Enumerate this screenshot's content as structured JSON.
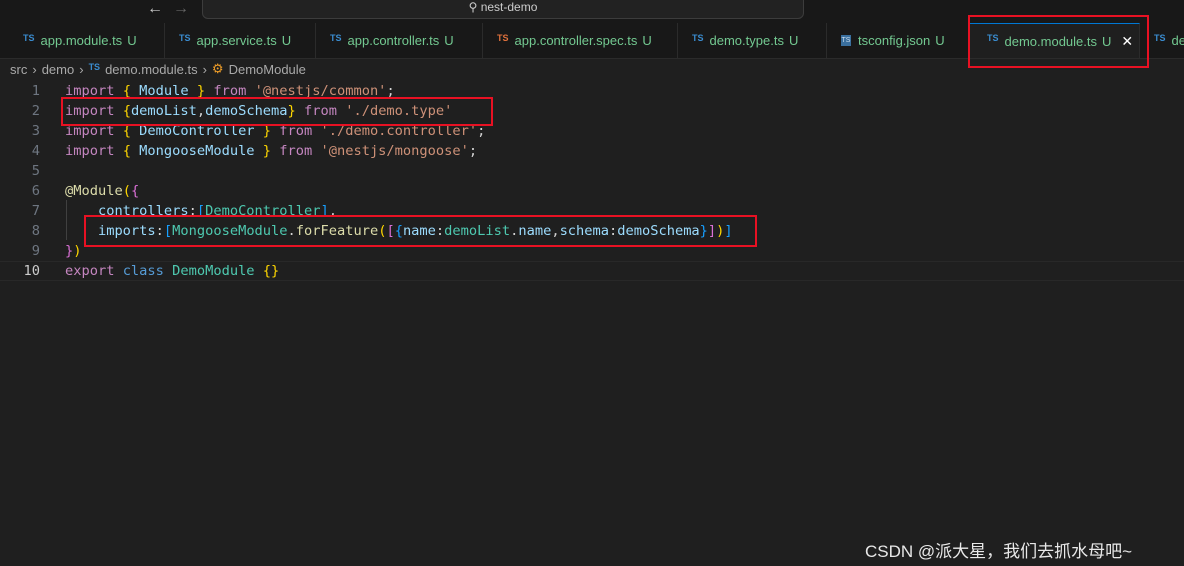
{
  "titlebar": {
    "back_icon": "arrow-left",
    "forward_icon": "arrow-right",
    "search": "nest-demo"
  },
  "tabs": [
    {
      "label": "app.module.ts",
      "badge": "U",
      "icon": "TS"
    },
    {
      "label": "app.service.ts",
      "badge": "U",
      "icon": "TS"
    },
    {
      "label": "app.controller.ts",
      "badge": "U",
      "icon": "TS"
    },
    {
      "label": "app.controller.spec.ts",
      "badge": "U",
      "icon": "TS"
    },
    {
      "label": "demo.type.ts",
      "badge": "U",
      "icon": "TS"
    },
    {
      "label": "tsconfig.json",
      "badge": "U",
      "icon": "TS"
    },
    {
      "label": "demo.module.ts",
      "badge": "U",
      "icon": "TS",
      "active": true
    },
    {
      "label": "de",
      "icon": "TS"
    }
  ],
  "breadcrumb": {
    "items": [
      "src",
      "demo",
      "demo.module.ts",
      "DemoModule"
    ],
    "file_icon": "TS"
  },
  "colors": {
    "kw": "#c586c0",
    "br": "#ffd700",
    "br2": "#da70d6",
    "br3": "#179fff",
    "id": "#9cdcfe",
    "cls": "#4ec9b0",
    "str": "#ce9178",
    "p": "#d4d4d4",
    "fn": "#dcdcaa",
    "k2": "#569cd6"
  },
  "code": [
    {
      "n": "1",
      "tokens": [
        {
          "t": "import ",
          "c": "kw"
        },
        {
          "t": "{",
          "c": "br"
        },
        {
          "t": " Module ",
          "c": "id"
        },
        {
          "t": "}",
          "c": "br"
        },
        {
          "t": " from ",
          "c": "kw"
        },
        {
          "t": "'@nestjs/common'",
          "c": "str"
        },
        {
          "t": ";",
          "c": "p"
        }
      ]
    },
    {
      "n": "2",
      "tokens": [
        {
          "t": "import ",
          "c": "kw"
        },
        {
          "t": "{",
          "c": "br"
        },
        {
          "t": "demoList",
          "c": "id"
        },
        {
          "t": ",",
          "c": "p"
        },
        {
          "t": "demoSchema",
          "c": "id"
        },
        {
          "t": "}",
          "c": "br"
        },
        {
          "t": " from ",
          "c": "kw"
        },
        {
          "t": "'./demo.type'",
          "c": "str"
        }
      ]
    },
    {
      "n": "3",
      "tokens": [
        {
          "t": "import ",
          "c": "kw"
        },
        {
          "t": "{",
          "c": "br"
        },
        {
          "t": " DemoController ",
          "c": "id"
        },
        {
          "t": "}",
          "c": "br"
        },
        {
          "t": " from ",
          "c": "kw"
        },
        {
          "t": "'./demo.controller'",
          "c": "str"
        },
        {
          "t": ";",
          "c": "p"
        }
      ]
    },
    {
      "n": "4",
      "tokens": [
        {
          "t": "import ",
          "c": "kw"
        },
        {
          "t": "{",
          "c": "br"
        },
        {
          "t": " MongooseModule ",
          "c": "id"
        },
        {
          "t": "}",
          "c": "br"
        },
        {
          "t": " from ",
          "c": "kw"
        },
        {
          "t": "'@nestjs/mongoose'",
          "c": "str"
        },
        {
          "t": ";",
          "c": "p"
        }
      ]
    },
    {
      "n": "5",
      "tokens": []
    },
    {
      "n": "6",
      "tokens": [
        {
          "t": "@Module",
          "c": "fn"
        },
        {
          "t": "(",
          "c": "br"
        },
        {
          "t": "{",
          "c": "br2"
        }
      ]
    },
    {
      "n": "7",
      "tokens": [
        {
          "t": "    controllers",
          "c": "id"
        },
        {
          "t": ":",
          "c": "p"
        },
        {
          "t": "[",
          "c": "br3"
        },
        {
          "t": "DemoController",
          "c": "cls"
        },
        {
          "t": "]",
          "c": "br3"
        },
        {
          "t": ",",
          "c": "p"
        }
      ]
    },
    {
      "n": "8",
      "tokens": [
        {
          "t": "    imports",
          "c": "id"
        },
        {
          "t": ":",
          "c": "p"
        },
        {
          "t": "[",
          "c": "br3"
        },
        {
          "t": "MongooseModule",
          "c": "cls"
        },
        {
          "t": ".",
          "c": "p"
        },
        {
          "t": "forFeature",
          "c": "fn"
        },
        {
          "t": "(",
          "c": "br"
        },
        {
          "t": "[",
          "c": "br2"
        },
        {
          "t": "{",
          "c": "br3"
        },
        {
          "t": "name",
          "c": "id"
        },
        {
          "t": ":",
          "c": "p"
        },
        {
          "t": "demoList",
          "c": "cls"
        },
        {
          "t": ".",
          "c": "p"
        },
        {
          "t": "name",
          "c": "id"
        },
        {
          "t": ",",
          "c": "p"
        },
        {
          "t": "schema",
          "c": "id"
        },
        {
          "t": ":",
          "c": "p"
        },
        {
          "t": "demoSchema",
          "c": "id"
        },
        {
          "t": "}",
          "c": "br3"
        },
        {
          "t": "]",
          "c": "br2"
        },
        {
          "t": ")",
          "c": "br"
        },
        {
          "t": "]",
          "c": "br3"
        }
      ]
    },
    {
      "n": "9",
      "tokens": [
        {
          "t": "}",
          "c": "br2"
        },
        {
          "t": ")",
          "c": "br"
        }
      ]
    },
    {
      "n": "10",
      "tokens": [
        {
          "t": "export ",
          "c": "kw"
        },
        {
          "t": "class ",
          "c": "k2"
        },
        {
          "t": "DemoModule ",
          "c": "cls"
        },
        {
          "t": "{}",
          "c": "br"
        }
      ],
      "current": true
    }
  ],
  "watermark": "CSDN @派大星，我们去抓水母吧~"
}
